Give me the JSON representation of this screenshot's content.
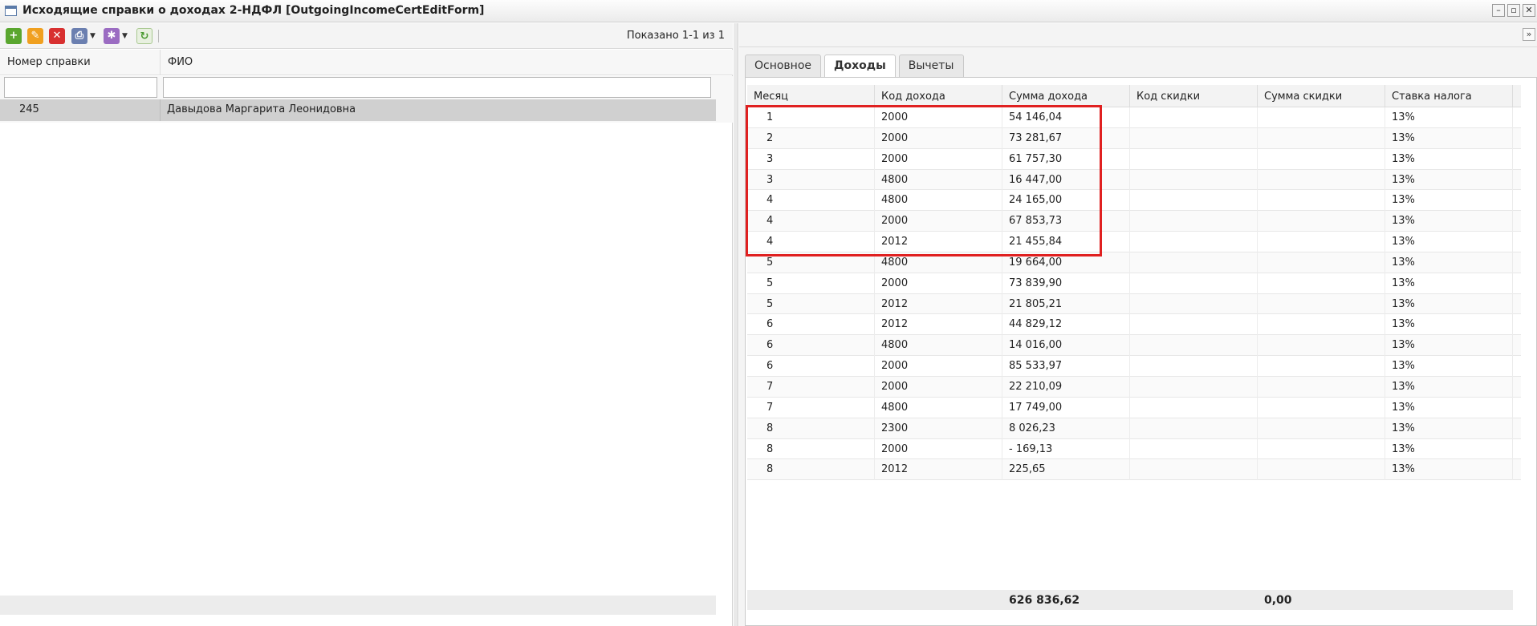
{
  "window": {
    "title": "Исходящие справки о доходах 2-НДФЛ [OutgoingIncomeCertEditForm]",
    "buttons": [
      "–",
      "▫",
      "✕"
    ]
  },
  "left_panel": {
    "toolbar": {
      "shown": "Показано 1-1 из 1"
    },
    "columns": [
      "Номер справки",
      "ФИО"
    ],
    "filters": {
      "number": "",
      "fio": ""
    },
    "rows": [
      {
        "number": "245",
        "fio": "Давыдова Маргарита Леонидовна"
      }
    ]
  },
  "right_panel": {
    "tabs": [
      {
        "label": "Основное",
        "active": false
      },
      {
        "label": "Доходы",
        "active": true
      },
      {
        "label": "Вычеты",
        "active": false
      }
    ],
    "columns": [
      "Месяц",
      "Код дохода",
      "Сумма дохода",
      "Код скидки",
      "Сумма скидки",
      "Ставка налога"
    ],
    "rows": [
      [
        "1",
        "2000",
        "54 146,04",
        "",
        "",
        "13%"
      ],
      [
        "2",
        "2000",
        "73 281,67",
        "",
        "",
        "13%"
      ],
      [
        "3",
        "2000",
        "61 757,30",
        "",
        "",
        "13%"
      ],
      [
        "3",
        "4800",
        "16 447,00",
        "",
        "",
        "13%"
      ],
      [
        "4",
        "4800",
        "24 165,00",
        "",
        "",
        "13%"
      ],
      [
        "4",
        "2000",
        "67 853,73",
        "",
        "",
        "13%"
      ],
      [
        "4",
        "2012",
        "21 455,84",
        "",
        "",
        "13%"
      ],
      [
        "5",
        "4800",
        "19 664,00",
        "",
        "",
        "13%"
      ],
      [
        "5",
        "2000",
        "73 839,90",
        "",
        "",
        "13%"
      ],
      [
        "5",
        "2012",
        "21 805,21",
        "",
        "",
        "13%"
      ],
      [
        "6",
        "2012",
        "44 829,12",
        "",
        "",
        "13%"
      ],
      [
        "6",
        "4800",
        "14 016,00",
        "",
        "",
        "13%"
      ],
      [
        "6",
        "2000",
        "85 533,97",
        "",
        "",
        "13%"
      ],
      [
        "7",
        "2000",
        "22 210,09",
        "",
        "",
        "13%"
      ],
      [
        "7",
        "4800",
        "17 749,00",
        "",
        "",
        "13%"
      ],
      [
        "8",
        "2300",
        "8 026,23",
        "",
        "",
        "13%"
      ],
      [
        "8",
        "2000",
        "- 169,13",
        "",
        "",
        "13%"
      ],
      [
        "8",
        "2012",
        "225,65",
        "",
        "",
        "13%"
      ]
    ],
    "totals": {
      "income_sum": "626 836,62",
      "discount_sum": "0,00"
    }
  },
  "colors": {
    "highlight": "#e02020",
    "selected_row": "#d0d0d0"
  }
}
